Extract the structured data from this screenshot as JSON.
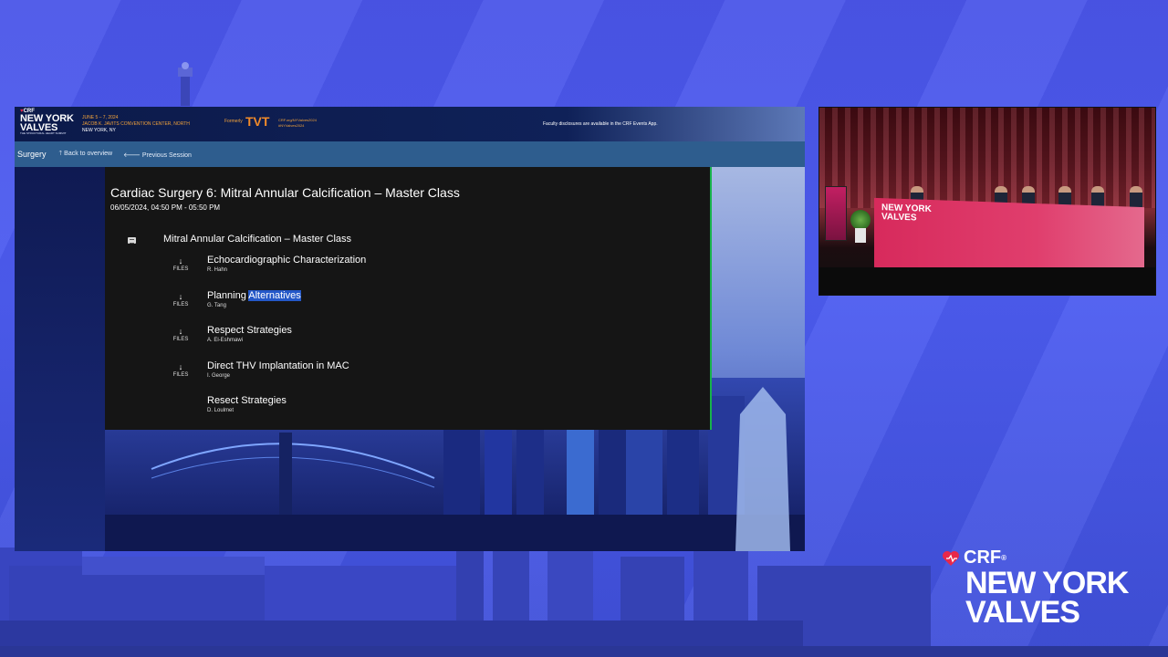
{
  "header": {
    "crf": "CRF",
    "logo_line1": "NEW YORK",
    "logo_line2": "VALVES",
    "logo_tagline": "THE STRUCTURAL HEART SUMMIT",
    "dates": "JUNE 5 – 7, 2024",
    "venue": "JACOB K. JAVITS CONVENTION CENTER, NORTH",
    "city": "NEW YORK, NY",
    "formerly": "Formerly",
    "tvt": "TVT",
    "link1": "CRF.org/NYValves2024",
    "link2": "#NYValves2024",
    "disclosure": "Faculty disclosures are available in the CRF Events App."
  },
  "nav": {
    "title": "Surgery",
    "back_label": "Back to overview",
    "prev_label": "Previous Session"
  },
  "session": {
    "title": "Cardiac Surgery 6: Mitral Annular Calcification – Master Class",
    "time": "06/05/2024, 04:50 PM - 05:50 PM",
    "name": "Mitral Annular Calcification – Master Class"
  },
  "files_label": "FILES",
  "talks": [
    {
      "title": "Echocardiographic Characterization",
      "speaker": "R. Hahn"
    },
    {
      "title_a": "Planning ",
      "title_b": "Alternatives",
      "speaker": "G. Tang"
    },
    {
      "title": "Respect Strategies",
      "speaker": "A. El-Eshmawi"
    },
    {
      "title": "Direct THV Implantation in MAC",
      "speaker": "I. George"
    },
    {
      "title": "Resect Strategies",
      "speaker": "D. Loulmet"
    }
  ],
  "video": {
    "logo_line1": "NEW YORK",
    "logo_line2": "VALVES"
  },
  "brand": {
    "crf": "CRF",
    "line1": "NEW YORK",
    "line2": "VALVES"
  },
  "colors": {
    "background": "#4a55e8",
    "nav_bar": "#2e5d8e",
    "agenda_bg": "#151515",
    "highlight": "#2458c8",
    "accent_orange": "#f3a33a",
    "accent_red": "#e8284a"
  }
}
